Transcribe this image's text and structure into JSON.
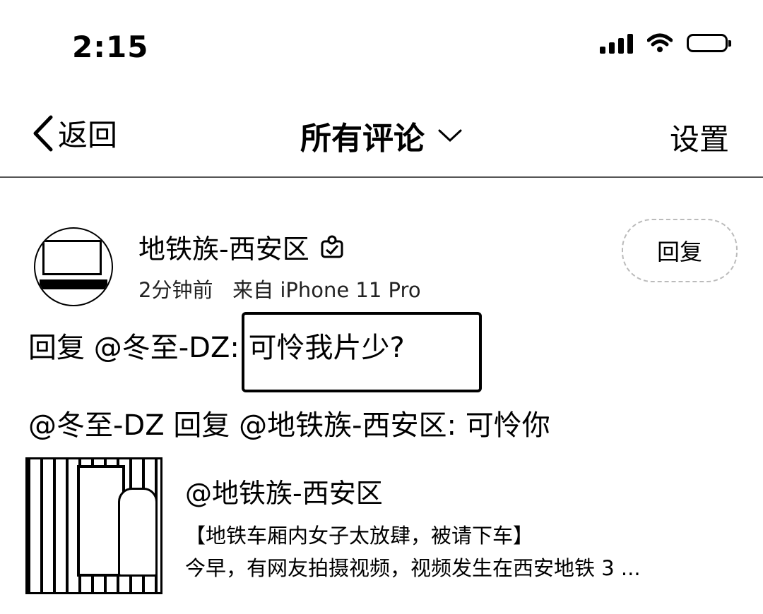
{
  "status": {
    "time": "2:15"
  },
  "nav": {
    "back_label": "返回",
    "title": "所有评论",
    "settings_label": "设置"
  },
  "comment": {
    "author": "地铁族-西安区",
    "time_ago": "2分钟前",
    "source": "来自 iPhone 11 Pro",
    "reply_button": "回复",
    "reply_text": "回复 @冬至-DZ: 可怜我片少?",
    "quoted_text": "@冬至-DZ 回复 @地铁族-西安区: 可怜你"
  },
  "original_post": {
    "user": "@地铁族-西安区",
    "title": "【地铁车厢内女子太放肆，被请下车】",
    "excerpt": "今早，有网友拍摄视频，视频发生在西安地铁 3 ..."
  },
  "icons": {
    "back": "chevron-left-icon",
    "dropdown": "chevron-down-icon",
    "signal": "signal-icon",
    "wifi": "wifi-icon",
    "battery": "battery-icon",
    "badge": "verified-badge-icon"
  }
}
